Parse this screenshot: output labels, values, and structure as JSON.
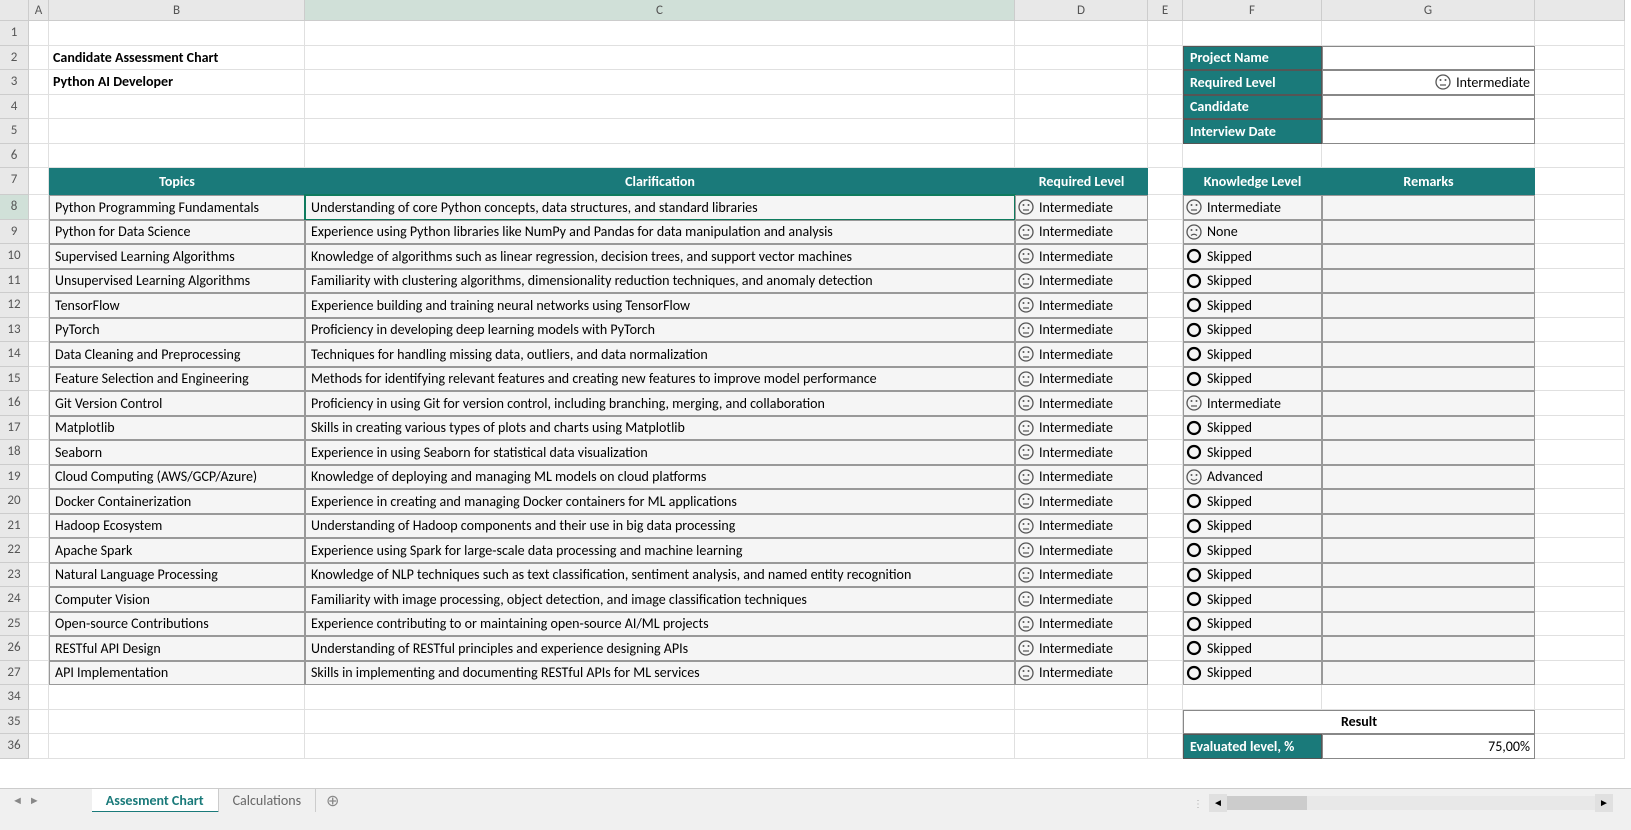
{
  "title": "Candidate Assessment Chart",
  "subtitle": "Python AI Developer",
  "columns": [
    "A",
    "B",
    "C",
    "D",
    "E",
    "F",
    "G"
  ],
  "info_labels": {
    "project": "Project Name",
    "required": "Required Level",
    "candidate": "Candidate",
    "date": "Interview Date"
  },
  "info_values": {
    "project": "",
    "required": "Intermediate",
    "candidate": "",
    "date": ""
  },
  "headers": {
    "topics": "Topics",
    "clarification": "Clarification",
    "required": "Required Level",
    "knowledge": "Knowledge Level",
    "remarks": "Remarks"
  },
  "rows": [
    {
      "topic": "Python Programming Fundamentals",
      "clar": "Understanding of core Python concepts, data structures, and standard libraries",
      "req": "Intermediate",
      "know": "Intermediate",
      "ktype": "neutral"
    },
    {
      "topic": "Python for Data Science",
      "clar": "Experience using Python libraries like NumPy and Pandas for data manipulation and analysis",
      "req": "Intermediate",
      "know": "None",
      "ktype": "sad"
    },
    {
      "topic": "Supervised Learning Algorithms",
      "clar": "Knowledge of algorithms such as linear regression, decision trees, and support vector machines",
      "req": "Intermediate",
      "know": "Skipped",
      "ktype": "skip"
    },
    {
      "topic": "Unsupervised Learning Algorithms",
      "clar": "Familiarity with clustering algorithms, dimensionality reduction techniques, and anomaly detection",
      "req": "Intermediate",
      "know": "Skipped",
      "ktype": "skip"
    },
    {
      "topic": "TensorFlow",
      "clar": "Experience building and training neural networks using TensorFlow",
      "req": "Intermediate",
      "know": "Skipped",
      "ktype": "skip"
    },
    {
      "topic": "PyTorch",
      "clar": "Proficiency in developing deep learning models with PyTorch",
      "req": "Intermediate",
      "know": "Skipped",
      "ktype": "skip"
    },
    {
      "topic": "Data Cleaning and Preprocessing",
      "clar": "Techniques for handling missing data, outliers, and data normalization",
      "req": "Intermediate",
      "know": "Skipped",
      "ktype": "skip"
    },
    {
      "topic": "Feature Selection and Engineering",
      "clar": "Methods for identifying relevant features and creating new features to improve model performance",
      "req": "Intermediate",
      "know": "Skipped",
      "ktype": "skip"
    },
    {
      "topic": "Git Version Control",
      "clar": "Proficiency in using Git for version control, including branching, merging, and collaboration",
      "req": "Intermediate",
      "know": "Intermediate",
      "ktype": "neutral"
    },
    {
      "topic": "Matplotlib",
      "clar": "Skills in creating various types of plots and charts using Matplotlib",
      "req": "Intermediate",
      "know": "Skipped",
      "ktype": "skip"
    },
    {
      "topic": "Seaborn",
      "clar": "Experience in using Seaborn for statistical data visualization",
      "req": "Intermediate",
      "know": "Skipped",
      "ktype": "skip"
    },
    {
      "topic": "Cloud Computing (AWS/GCP/Azure)",
      "clar": "Knowledge of deploying and managing ML models on cloud platforms",
      "req": "Intermediate",
      "know": "Advanced",
      "ktype": "happy"
    },
    {
      "topic": "Docker Containerization",
      "clar": "Experience in creating and managing Docker containers for ML applications",
      "req": "Intermediate",
      "know": "Skipped",
      "ktype": "skip"
    },
    {
      "topic": "Hadoop Ecosystem",
      "clar": "Understanding of Hadoop components and their use in big data processing",
      "req": "Intermediate",
      "know": "Skipped",
      "ktype": "skip"
    },
    {
      "topic": "Apache Spark",
      "clar": "Experience using Spark for large-scale data processing and machine learning",
      "req": "Intermediate",
      "know": "Skipped",
      "ktype": "skip"
    },
    {
      "topic": "Natural Language Processing",
      "clar": "Knowledge of NLP techniques such as text classification, sentiment analysis, and named entity recognition",
      "req": "Intermediate",
      "know": "Skipped",
      "ktype": "skip"
    },
    {
      "topic": "Computer Vision",
      "clar": "Familiarity with image processing, object detection, and image classification techniques",
      "req": "Intermediate",
      "know": "Skipped",
      "ktype": "skip"
    },
    {
      "topic": "Open-source Contributions",
      "clar": "Experience contributing to or maintaining open-source AI/ML projects",
      "req": "Intermediate",
      "know": "Skipped",
      "ktype": "skip"
    },
    {
      "topic": "RESTful API Design",
      "clar": "Understanding of RESTful principles and experience designing APIs",
      "req": "Intermediate",
      "know": "Skipped",
      "ktype": "skip"
    },
    {
      "topic": "API Implementation",
      "clar": "Skills in implementing and documenting RESTful APIs for ML services",
      "req": "Intermediate",
      "know": "Skipped",
      "ktype": "skip"
    }
  ],
  "result": {
    "title": "Result",
    "label": "Evaluated level, %",
    "value": "75,00%"
  },
  "tabs": {
    "active": "Assesment Chart",
    "other": "Calculations"
  }
}
